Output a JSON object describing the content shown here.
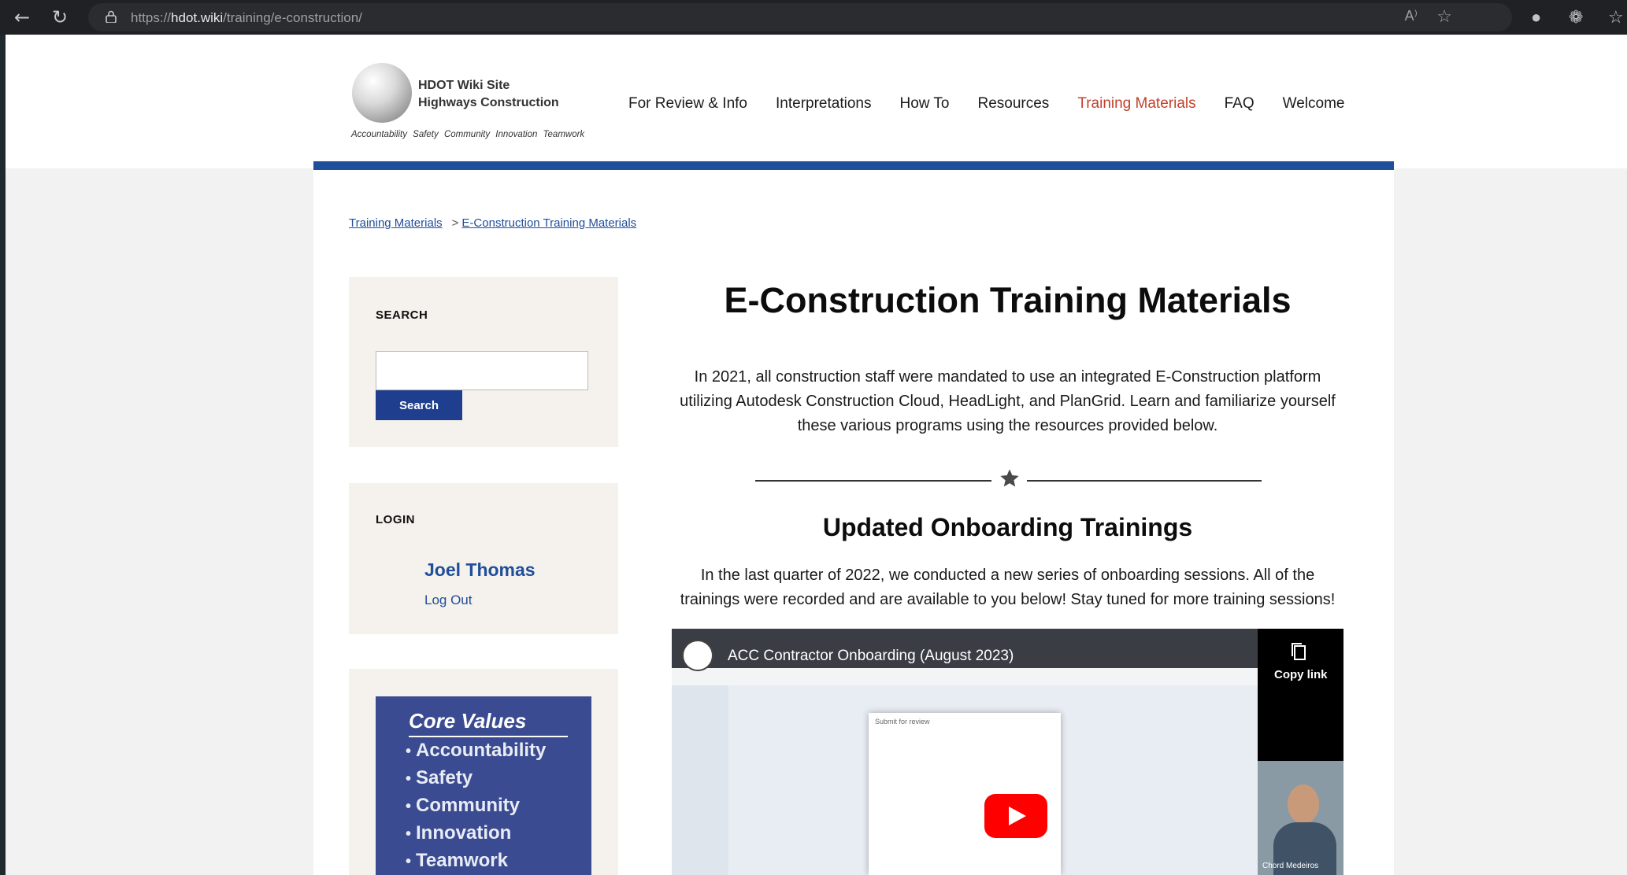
{
  "browser": {
    "url_prefix": "https://",
    "url_host": "hdot.wiki",
    "url_path": "/training/e-construction/",
    "read_aloud_icon": "read-aloud-icon",
    "favorite_icon": "star-outline-icon"
  },
  "site": {
    "title_line1": "HDOT Wiki Site",
    "title_line2": "Highways Construction",
    "tagline": "Accountability Safety Community Innovation Teamwork"
  },
  "nav": {
    "items": [
      {
        "label": "For Review & Info"
      },
      {
        "label": "Interpretations"
      },
      {
        "label": "How To"
      },
      {
        "label": "Resources"
      },
      {
        "label": "Training Materials",
        "active": true
      },
      {
        "label": "FAQ"
      },
      {
        "label": "Welcome"
      }
    ]
  },
  "breadcrumb": {
    "items": [
      "Training Materials",
      "E-Construction Training Materials"
    ],
    "separator": ">"
  },
  "sidebar": {
    "search": {
      "heading": "SEARCH",
      "placeholder": "",
      "button": "Search"
    },
    "login": {
      "heading": "LOGIN",
      "user": "Joel Thomas",
      "logout": "Log Out"
    },
    "core_values": {
      "title": "Core Values",
      "items": [
        "Accountability",
        "Safety",
        "Community",
        "Innovation",
        "Teamwork"
      ]
    }
  },
  "main": {
    "title": "E-Construction Training Materials",
    "intro": "In 2021, all construction staff were mandated to use an integrated E-Construction platform utilizing Autodesk Construction Cloud, HeadLight, and PlanGrid. Learn and familiarize yourself these various programs using the resources provided below.",
    "section_title": "Updated Onboarding Trainings",
    "section_text": "In the last quarter of 2022, we conducted a new series of onboarding sessions. All of the trainings were recorded and are available to you below! Stay tuned for more training sessions!",
    "video": {
      "title": "ACC Contractor Onboarding (August 2023)",
      "copy_label": "Copy link",
      "modal_title": "Submit for review",
      "presenter": "Chord Medeiros"
    }
  },
  "colors": {
    "accent_blue": "#1f4e9a",
    "active_nav": "#c2402c",
    "button_blue": "#1f3f8e",
    "core_values_bg": "#3a4b91",
    "sidebar_bg": "#f5f1ec"
  }
}
